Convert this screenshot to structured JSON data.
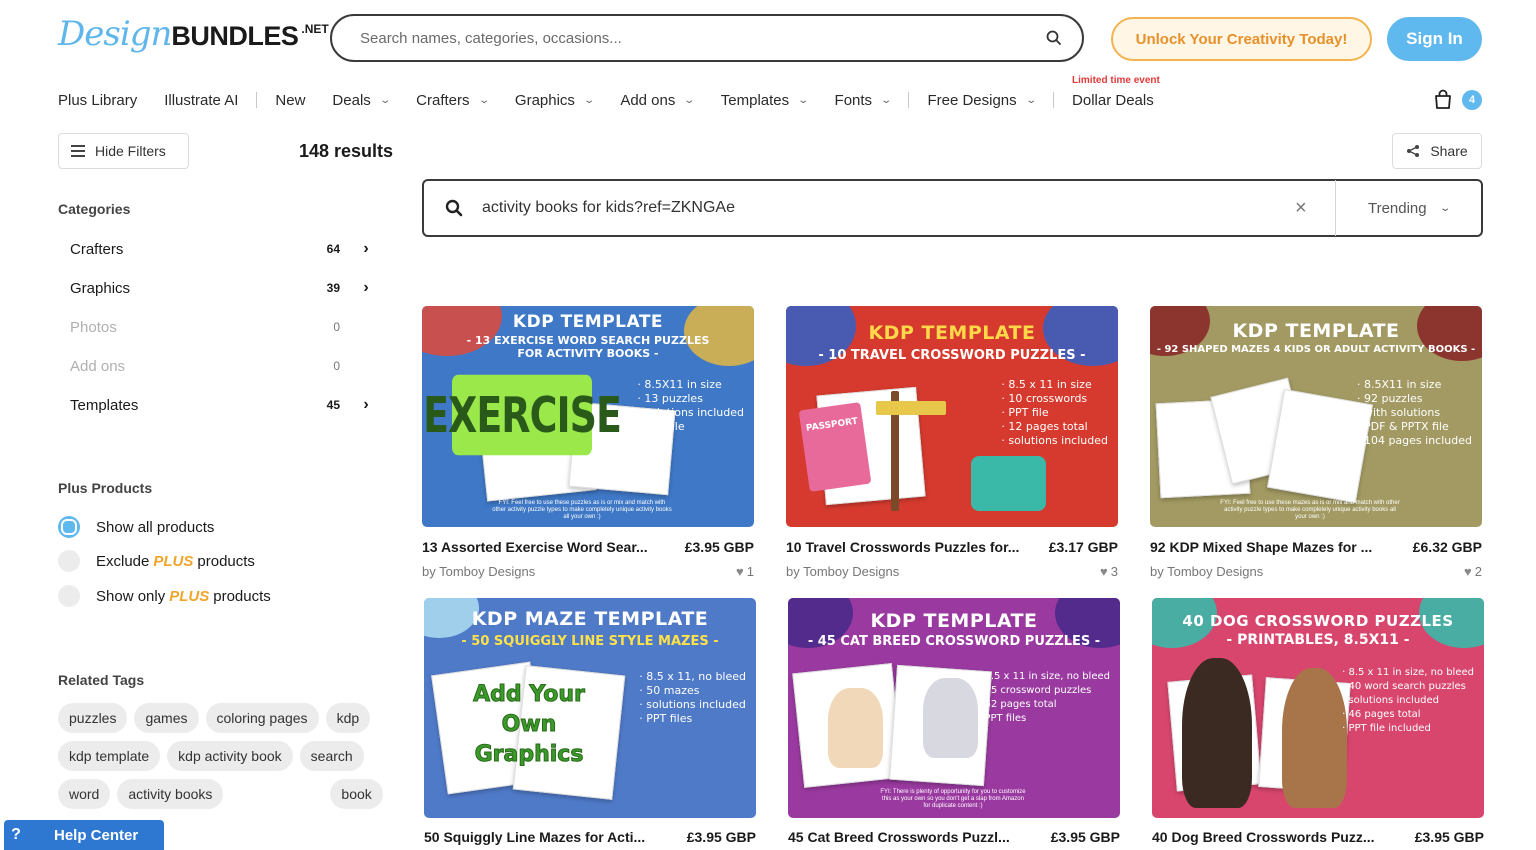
{
  "logo": {
    "design": "Design",
    "bundles": "BUNDLES",
    "net": ".NET"
  },
  "top_search": {
    "placeholder": "Search names, categories, occasions..."
  },
  "header": {
    "unlock_label": "Unlock Your Creativity Today!",
    "signin_label": "Sign In"
  },
  "nav": {
    "plus_library": "Plus Library",
    "illustrate_ai": "Illustrate AI",
    "new": "New",
    "deals": "Deals",
    "crafters": "Crafters",
    "graphics": "Graphics",
    "add_ons": "Add ons",
    "templates": "Templates",
    "fonts": "Fonts",
    "free_designs": "Free Designs",
    "limited": "Limited time event",
    "dollar_deals": "Dollar Deals",
    "cart_count": "4"
  },
  "filters": {
    "hide_label": "Hide Filters",
    "results": "148 results",
    "share_label": "Share"
  },
  "sidebar": {
    "categories_title": "Categories",
    "categories": [
      {
        "label": "Crafters",
        "count": "64"
      },
      {
        "label": "Graphics",
        "count": "39"
      },
      {
        "label": "Photos",
        "count": "0"
      },
      {
        "label": "Add ons",
        "count": "0"
      },
      {
        "label": "Templates",
        "count": "45"
      }
    ],
    "plus_title": "Plus Products",
    "plus_options": [
      {
        "pre": "Show all products",
        "post": ""
      },
      {
        "pre": "Exclude",
        "post": "products"
      },
      {
        "pre": "Show only",
        "post": "products"
      }
    ],
    "plus_word": "PLUS",
    "tags_title": "Related Tags",
    "tags": [
      "puzzles",
      "games",
      "coloring pages",
      "kdp",
      "kdp template",
      "kdp activity book",
      "search",
      "word",
      "activity books",
      "book"
    ]
  },
  "help": {
    "icon": "?",
    "label": "Help Center"
  },
  "main_search": {
    "query": "activity books for kids?ref=ZKNGAe",
    "sort": "Trending"
  },
  "colors": {
    "accent": "#5fb8ee",
    "unlock": "#e8912a",
    "help": "#2f78d2"
  },
  "products": [
    {
      "title": "13 Assorted Exercise Word Sear...",
      "price": "£3.95 GBP",
      "author": "by Tomboy Designs",
      "likes": "1",
      "thumb": {
        "h1": "KDP TEMPLATE",
        "h2": "- 13 EXERCISE WORD SEARCH PUZZLES FOR ACTIVITY BOOKS -",
        "big": "EXERCISE",
        "bullets": "· 8.5X11 in size\n· 13 puzzles\n· solutions included\n· PPT file",
        "fyi": "FYI: Feel free to use these puzzles as is or mix and match with other activity puzzle types to make completely unique activity books all your own :)"
      }
    },
    {
      "title": "10 Travel Crosswords Puzzles for...",
      "price": "£3.17 GBP",
      "author": "by Tomboy Designs",
      "likes": "3",
      "thumb": {
        "h1": "KDP TEMPLATE",
        "h2": "- 10 TRAVEL CROSSWORD PUZZLES -",
        "big": "PASSPORT",
        "bullets": "· 8.5 x 11 in size\n· 10 crosswords\n· PPT file\n· 12 pages total\n· solutions included",
        "fyi": ""
      }
    },
    {
      "title": "92 KDP Mixed Shape Mazes for ...",
      "price": "£6.32 GBP",
      "author": "by Tomboy Designs",
      "likes": "2",
      "thumb": {
        "h1": "KDP TEMPLATE",
        "h2": "- 92 SHAPED MAZES 4 KIDS OR ADULT ACTIVITY BOOKS -",
        "big": "",
        "bullets": "· 8.5X11 in size\n· 92 puzzles\n· with solutions\n· PDF & PPTX file\n· 104 pages included",
        "fyi": "FYI: Feel free to use these mazes as is or mix and match with other activity puzzle types to make completely unique activity books all your own :)"
      }
    },
    {
      "title": "50 Squiggly Line Mazes for Acti...",
      "price": "£3.95 GBP",
      "author": "",
      "likes": "",
      "thumb": {
        "h1": "KDP MAZE TEMPLATE",
        "h2": "- 50 SQUIGGLY LINE STYLE MAZES -",
        "big": "Add Your Own Graphics",
        "bullets": "· 8.5 x 11, no bleed\n· 50 mazes\n· solutions included\n· PPT files",
        "fyi": ""
      }
    },
    {
      "title": "45 Cat Breed Crosswords Puzzl...",
      "price": "£3.95 GBP",
      "author": "",
      "likes": "",
      "thumb": {
        "h1": "KDP TEMPLATE",
        "h2": "- 45 CAT BREED CROSSWORD PUZZLES -",
        "big": "",
        "bullets": "· 8.5 x 11 in size, no bleed\n· 45 crossword puzzles\n· 62 pages total\n· PPT files",
        "fyi": "FYI: There is plenty of opportunity for you to customize this as your own so you don't get a slap from Amazon for duplicate content :)"
      }
    },
    {
      "title": "40 Dog Breed Crosswords Puzz...",
      "price": "£3.95 GBP",
      "author": "",
      "likes": "",
      "thumb": {
        "h1": "40 DOG CROSSWORD PUZZLES",
        "h2": "- PRINTABLES, 8.5X11 -",
        "big": "",
        "bullets": "· 8.5 x 11 in size, no bleed\n· 40 word search puzzles\n· solutions included\n· 46 pages total\n· PPT file included",
        "fyi": ""
      }
    }
  ]
}
